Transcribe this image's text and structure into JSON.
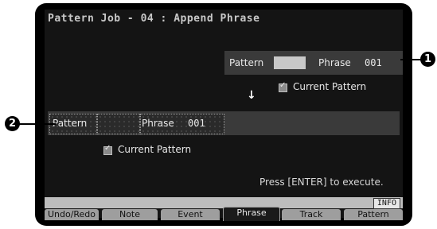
{
  "screen": {
    "title": "Pattern Job - 04 : Append Phrase",
    "source": {
      "pattern_label": "Pattern",
      "pattern_value": "",
      "phrase_label": "Phrase",
      "phrase_value": "001"
    },
    "source_current_pattern": "Current Pattern",
    "dest": {
      "pattern_label": "Pattern",
      "pattern_value": "",
      "phrase_label": "Phrase",
      "phrase_value": "001"
    },
    "dest_current_pattern": "Current Pattern",
    "hint": "Press [ENTER] to execute.",
    "info_button": "INFO",
    "tabs": [
      "Undo/Redo",
      "Note",
      "Event",
      "Phrase",
      "Track",
      "Pattern"
    ],
    "active_tab": "Phrase"
  },
  "callouts": [
    "1",
    "2"
  ]
}
